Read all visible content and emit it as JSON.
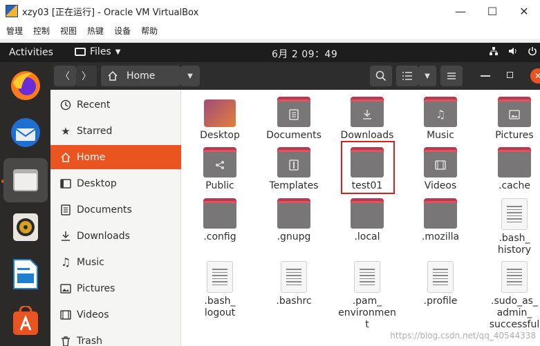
{
  "host": {
    "window_title": "xzy03 [正在运行] - Oracle VM VirtualBox",
    "menu": [
      "管理",
      "控制",
      "视图",
      "热键",
      "设备",
      "帮助"
    ],
    "minimize": "—",
    "maximize": "☐",
    "close": "✕"
  },
  "topbar": {
    "activities": "Activities",
    "app_menu": "Files",
    "clock": "6月 2 09：49"
  },
  "headerbar": {
    "back": "〈",
    "forward": "〉",
    "location": "Home"
  },
  "sidebar": {
    "items": [
      {
        "label": "Recent",
        "icon": "clock-icon"
      },
      {
        "label": "Starred",
        "icon": "star-icon"
      },
      {
        "label": "Home",
        "icon": "home-icon",
        "selected": true
      },
      {
        "label": "Desktop",
        "icon": "desktop-icon"
      },
      {
        "label": "Documents",
        "icon": "document-icon"
      },
      {
        "label": "Downloads",
        "icon": "download-icon"
      },
      {
        "label": "Music",
        "icon": "music-icon"
      },
      {
        "label": "Pictures",
        "icon": "picture-icon"
      },
      {
        "label": "Videos",
        "icon": "video-icon"
      },
      {
        "label": "Trash",
        "icon": "trash-icon"
      }
    ]
  },
  "files": [
    {
      "name": "Desktop",
      "kind": "desktop"
    },
    {
      "name": "Documents",
      "kind": "folder",
      "emblem": "document"
    },
    {
      "name": "Downloads",
      "kind": "folder",
      "emblem": "download"
    },
    {
      "name": "Music",
      "kind": "folder",
      "emblem": "music"
    },
    {
      "name": "Pictures",
      "kind": "folder",
      "emblem": "picture"
    },
    {
      "name": "Public",
      "kind": "folder",
      "emblem": "share"
    },
    {
      "name": "Templates",
      "kind": "folder",
      "emblem": "template"
    },
    {
      "name": "test01",
      "kind": "folder",
      "selected": true
    },
    {
      "name": "Videos",
      "kind": "folder",
      "emblem": "video"
    },
    {
      "name": ".cache",
      "kind": "folder"
    },
    {
      "name": ".config",
      "kind": "folder"
    },
    {
      "name": ".gnupg",
      "kind": "folder"
    },
    {
      "name": ".local",
      "kind": "folder"
    },
    {
      "name": ".mozilla",
      "kind": "folder"
    },
    {
      "name": ".bash_\nhistory",
      "kind": "doc"
    },
    {
      "name": ".bash_\nlogout",
      "kind": "doc"
    },
    {
      "name": ".bashrc",
      "kind": "doc"
    },
    {
      "name": ".pam_\nenvironmen\nt",
      "kind": "doc"
    },
    {
      "name": ".profile",
      "kind": "doc"
    },
    {
      "name": ".sudo_as_\nadmin_\nsuccessful",
      "kind": "doc"
    }
  ],
  "watermark": "https://blog.csdn.net/qq_40544338",
  "colors": {
    "accent": "#e95420",
    "folder_body": "#787676",
    "folder_tab": "#e5525e"
  }
}
